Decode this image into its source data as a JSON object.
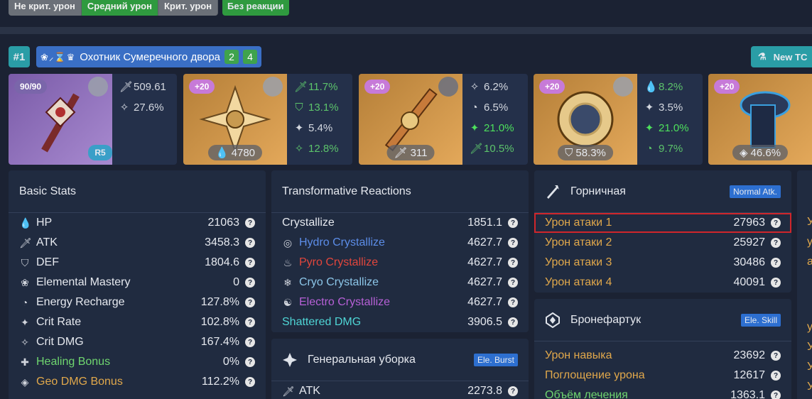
{
  "top_tabs": [
    "Не крит. урон",
    "Средний урон",
    "Крит. урон"
  ],
  "no_reaction": "Без реакции",
  "build": {
    "rank": "#1",
    "set_icons": "❀⸝⌛♛",
    "set_name": "Охотник Сумеречного двора",
    "count_a": "2",
    "count_b": "4",
    "new_tc": "New TC"
  },
  "weapon": {
    "level": "90/90",
    "refine": "R5",
    "base_atk": "509.61",
    "substat": "27.6%"
  },
  "artifacts": [
    {
      "level": "+20",
      "main": "4780",
      "subs": [
        "11.7%",
        "13.1%",
        "5.4%",
        "12.8%"
      ]
    },
    {
      "level": "+20",
      "main": "311",
      "subs": [
        "6.2%",
        "6.5%",
        "21.0%",
        "10.5%"
      ]
    },
    {
      "level": "+20",
      "main": "58.3%",
      "subs": [
        "8.2%",
        "3.5%",
        "21.0%",
        "9.7%"
      ]
    },
    {
      "level": "+20",
      "main": "46.6%"
    }
  ],
  "basic": {
    "title": "Basic Stats",
    "rows": [
      {
        "label": "HP",
        "value": "21063"
      },
      {
        "label": "ATK",
        "value": "3458.3"
      },
      {
        "label": "DEF",
        "value": "1804.6"
      },
      {
        "label": "Elemental Mastery",
        "value": "0"
      },
      {
        "label": "Energy Recharge",
        "value": "127.8%"
      },
      {
        "label": "Crit Rate",
        "value": "102.8%"
      },
      {
        "label": "Crit DMG",
        "value": "167.4%"
      },
      {
        "label": "Healing Bonus",
        "value": "0%"
      },
      {
        "label": "Geo DMG Bonus",
        "value": "112.2%"
      }
    ]
  },
  "transform": {
    "title": "Transformative Reactions",
    "rows": [
      {
        "label": "Crystallize",
        "value": "1851.1"
      },
      {
        "label": "Hydro Crystallize",
        "value": "4627.7"
      },
      {
        "label": "Pyro Crystallize",
        "value": "4627.7"
      },
      {
        "label": "Cryo Crystallize",
        "value": "4627.7"
      },
      {
        "label": "Electro Crystallize",
        "value": "4627.7"
      },
      {
        "label": "Shattered DMG",
        "value": "3906.5"
      }
    ]
  },
  "burst": {
    "title": "Генеральная уборка",
    "chip": "Ele. Burst",
    "rows": [
      {
        "label": "ATK",
        "value": "2273.8"
      }
    ]
  },
  "normal": {
    "title": "Горничная",
    "chip": "Normal Atk.",
    "rows": [
      {
        "label": "Урон атаки 1",
        "value": "27963"
      },
      {
        "label": "Урон атаки 2",
        "value": "25927"
      },
      {
        "label": "Урон атаки 3",
        "value": "30486"
      },
      {
        "label": "Урон атаки 4",
        "value": "40091"
      }
    ]
  },
  "skill": {
    "title": "Бронефартук",
    "chip": "Ele. Skill",
    "rows": [
      {
        "label": "Урон навыка",
        "value": "23692"
      },
      {
        "label": "Поглощение урона",
        "value": "12617"
      },
      {
        "label": "Объём лечения",
        "value": "1363.1"
      }
    ]
  },
  "cutoff_column": {
    "chars": [
      "У",
      "у",
      "а",
      "у",
      "У",
      "У",
      "У"
    ]
  }
}
